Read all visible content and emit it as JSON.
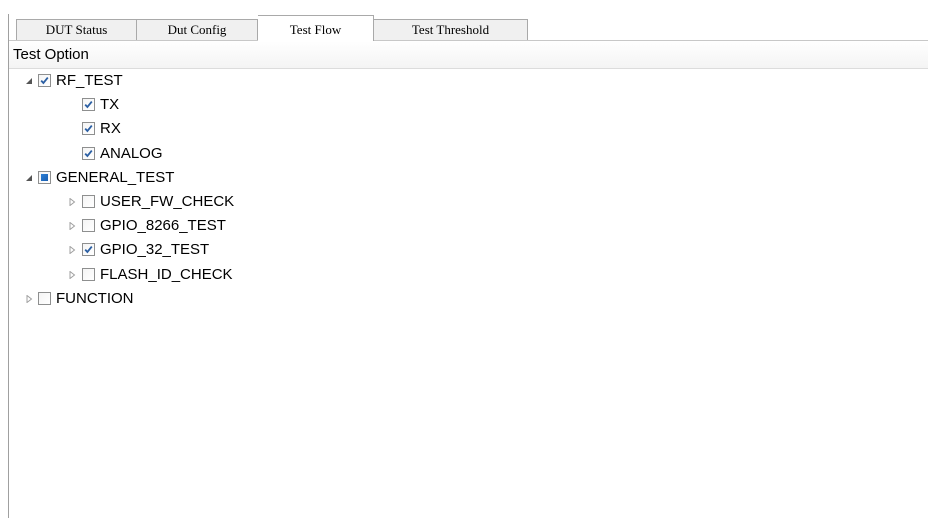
{
  "tabs": [
    {
      "label": "DUT Status",
      "active": false
    },
    {
      "label": "Dut Config",
      "active": false
    },
    {
      "label": "Test Flow",
      "active": true
    },
    {
      "label": "Test Threshold",
      "active": false
    }
  ],
  "header": {
    "title": "Test Option"
  },
  "tree": [
    {
      "label": "RF_TEST",
      "level": 0,
      "expander": "expanded",
      "state": "checked"
    },
    {
      "label": "TX",
      "level": 1,
      "expander": "none",
      "state": "checked"
    },
    {
      "label": "RX",
      "level": 1,
      "expander": "none",
      "state": "checked"
    },
    {
      "label": "ANALOG",
      "level": 1,
      "expander": "none",
      "state": "checked"
    },
    {
      "label": "GENERAL_TEST",
      "level": 0,
      "expander": "expanded",
      "state": "partial"
    },
    {
      "label": "USER_FW_CHECK",
      "level": 1,
      "expander": "collapsed",
      "state": "unchecked"
    },
    {
      "label": "GPIO_8266_TEST",
      "level": 1,
      "expander": "collapsed",
      "state": "unchecked"
    },
    {
      "label": "GPIO_32_TEST",
      "level": 1,
      "expander": "collapsed",
      "state": "checked"
    },
    {
      "label": "FLASH_ID_CHECK",
      "level": 1,
      "expander": "collapsed",
      "state": "unchecked"
    },
    {
      "label": "FUNCTION",
      "level": 0,
      "expander": "collapsed",
      "state": "unchecked"
    }
  ],
  "colors": {
    "check": "#2b5fa3",
    "partial": "#1f6fc4",
    "tab_border": "#a9a9a9"
  }
}
